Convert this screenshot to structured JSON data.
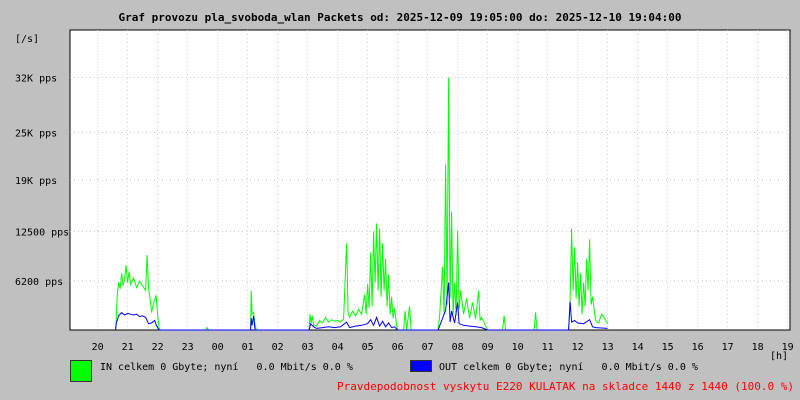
{
  "chart_data": {
    "type": "area",
    "title": "Graf provozu pla_svoboda_wlan Packets od: 2025-12-09 19:05:00 do: 2025-12-10 19:04:00",
    "ylabel": "[/s]",
    "xlabel": "[h]",
    "ylim": [
      0,
      38000
    ],
    "y_ticks": [
      {
        "label": "6200 pps",
        "value": 6200
      },
      {
        "label": "12500 pps",
        "value": 12500
      },
      {
        "label": "19K pps",
        "value": 19000
      },
      {
        "label": "25K pps",
        "value": 25000
      },
      {
        "label": "32K pps",
        "value": 32000
      }
    ],
    "x_ticks": [
      "20",
      "21",
      "22",
      "23",
      "00",
      "01",
      "02",
      "03",
      "04",
      "05",
      "06",
      "07",
      "08",
      "09",
      "10",
      "11",
      "12",
      "13",
      "14",
      "15",
      "16",
      "17",
      "18",
      "19"
    ],
    "xlim_hours": [
      19.08,
      24.0
    ],
    "series": [
      {
        "name": "IN",
        "color": "#00ff00",
        "points": [
          [
            20.6,
            0
          ],
          [
            20.62,
            1200
          ],
          [
            20.65,
            4200
          ],
          [
            20.7,
            6000
          ],
          [
            20.75,
            5200
          ],
          [
            20.8,
            7200
          ],
          [
            20.85,
            5600
          ],
          [
            20.9,
            6500
          ],
          [
            20.95,
            8200
          ],
          [
            21.0,
            6000
          ],
          [
            21.05,
            7400
          ],
          [
            21.1,
            5800
          ],
          [
            21.2,
            6600
          ],
          [
            21.3,
            5400
          ],
          [
            21.4,
            6200
          ],
          [
            21.5,
            5600
          ],
          [
            21.6,
            5000
          ],
          [
            21.65,
            9500
          ],
          [
            21.7,
            5200
          ],
          [
            21.75,
            4000
          ],
          [
            21.8,
            2200
          ],
          [
            21.85,
            3200
          ],
          [
            21.9,
            3800
          ],
          [
            21.95,
            4400
          ],
          [
            22.0,
            2000
          ],
          [
            22.05,
            200
          ],
          [
            22.1,
            0
          ],
          [
            23.6,
            0
          ],
          [
            23.65,
            300
          ],
          [
            23.7,
            0
          ],
          [
            25.1,
            0
          ],
          [
            25.12,
            5000
          ],
          [
            25.15,
            2000
          ],
          [
            25.2,
            2200
          ],
          [
            25.25,
            600
          ],
          [
            25.3,
            0
          ],
          [
            27.05,
            0
          ],
          [
            27.08,
            2000
          ],
          [
            27.12,
            900
          ],
          [
            27.16,
            1800
          ],
          [
            27.2,
            600
          ],
          [
            27.3,
            500
          ],
          [
            27.4,
            1200
          ],
          [
            27.5,
            900
          ],
          [
            27.6,
            1600
          ],
          [
            27.7,
            1000
          ],
          [
            27.8,
            1300
          ],
          [
            27.9,
            1100
          ],
          [
            28.0,
            1200
          ],
          [
            28.1,
            1000
          ],
          [
            28.2,
            1400
          ],
          [
            28.3,
            11000
          ],
          [
            28.35,
            2200
          ],
          [
            28.4,
            1600
          ],
          [
            28.5,
            2400
          ],
          [
            28.6,
            1800
          ],
          [
            28.7,
            2600
          ],
          [
            28.8,
            2000
          ],
          [
            28.9,
            4500
          ],
          [
            28.95,
            2000
          ],
          [
            29.0,
            5800
          ],
          [
            29.05,
            2800
          ],
          [
            29.1,
            9800
          ],
          [
            29.15,
            3000
          ],
          [
            29.2,
            12500
          ],
          [
            29.25,
            6000
          ],
          [
            29.3,
            13500
          ],
          [
            29.35,
            5000
          ],
          [
            29.4,
            12800
          ],
          [
            29.45,
            4200
          ],
          [
            29.5,
            11000
          ],
          [
            29.55,
            5000
          ],
          [
            29.6,
            9000
          ],
          [
            29.65,
            3000
          ],
          [
            29.7,
            7000
          ],
          [
            29.75,
            2000
          ],
          [
            29.8,
            4200
          ],
          [
            29.85,
            1500
          ],
          [
            29.9,
            2800
          ],
          [
            29.95,
            1000
          ],
          [
            30.0,
            0
          ],
          [
            30.2,
            0
          ],
          [
            30.25,
            2400
          ],
          [
            30.3,
            0
          ],
          [
            30.4,
            3000
          ],
          [
            30.45,
            0
          ],
          [
            31.35,
            0
          ],
          [
            31.4,
            1800
          ],
          [
            31.5,
            8000
          ],
          [
            31.55,
            2000
          ],
          [
            31.6,
            21000
          ],
          [
            31.65,
            3200
          ],
          [
            31.7,
            32000
          ],
          [
            31.75,
            4000
          ],
          [
            31.8,
            15000
          ],
          [
            31.85,
            2000
          ],
          [
            31.9,
            6000
          ],
          [
            31.95,
            1800
          ],
          [
            32.0,
            12500
          ],
          [
            32.05,
            2600
          ],
          [
            32.1,
            5000
          ],
          [
            32.2,
            2000
          ],
          [
            32.3,
            4000
          ],
          [
            32.4,
            1500
          ],
          [
            32.5,
            3500
          ],
          [
            32.6,
            1400
          ],
          [
            32.7,
            5000
          ],
          [
            32.75,
            1200
          ],
          [
            32.8,
            1600
          ],
          [
            32.9,
            800
          ],
          [
            33.0,
            0
          ],
          [
            33.5,
            0
          ],
          [
            33.55,
            1800
          ],
          [
            33.6,
            0
          ],
          [
            34.55,
            0
          ],
          [
            34.6,
            2200
          ],
          [
            34.65,
            0
          ],
          [
            35.7,
            0
          ],
          [
            35.75,
            3800
          ],
          [
            35.8,
            12800
          ],
          [
            35.85,
            5000
          ],
          [
            35.9,
            10500
          ],
          [
            35.95,
            4000
          ],
          [
            36.0,
            8500
          ],
          [
            36.05,
            3000
          ],
          [
            36.1,
            7200
          ],
          [
            36.15,
            2000
          ],
          [
            36.2,
            6000
          ],
          [
            36.25,
            3000
          ],
          [
            36.3,
            9000
          ],
          [
            36.35,
            5000
          ],
          [
            36.4,
            11500
          ],
          [
            36.45,
            3200
          ],
          [
            36.5,
            4200
          ],
          [
            36.6,
            1200
          ],
          [
            36.7,
            900
          ],
          [
            36.8,
            2000
          ],
          [
            36.9,
            1500
          ],
          [
            37.0,
            800
          ]
        ]
      },
      {
        "name": "OUT",
        "color": "#0000ff",
        "points": [
          [
            20.6,
            0
          ],
          [
            20.62,
            800
          ],
          [
            20.7,
            1800
          ],
          [
            20.8,
            2200
          ],
          [
            20.9,
            1900
          ],
          [
            21.0,
            2100
          ],
          [
            21.1,
            2000
          ],
          [
            21.2,
            1900
          ],
          [
            21.3,
            2000
          ],
          [
            21.4,
            1700
          ],
          [
            21.5,
            1800
          ],
          [
            21.6,
            1600
          ],
          [
            21.7,
            800
          ],
          [
            21.8,
            900
          ],
          [
            21.9,
            1200
          ],
          [
            21.95,
            700
          ],
          [
            22.0,
            300
          ],
          [
            22.05,
            0
          ],
          [
            25.1,
            0
          ],
          [
            25.12,
            1500
          ],
          [
            25.15,
            600
          ],
          [
            25.2,
            1800
          ],
          [
            25.25,
            0
          ],
          [
            27.05,
            0
          ],
          [
            27.1,
            800
          ],
          [
            27.2,
            400
          ],
          [
            27.3,
            200
          ],
          [
            27.5,
            300
          ],
          [
            27.7,
            400
          ],
          [
            27.9,
            300
          ],
          [
            28.1,
            400
          ],
          [
            28.3,
            1000
          ],
          [
            28.4,
            300
          ],
          [
            28.6,
            500
          ],
          [
            28.8,
            600
          ],
          [
            29.0,
            800
          ],
          [
            29.1,
            1300
          ],
          [
            29.2,
            600
          ],
          [
            29.3,
            1600
          ],
          [
            29.4,
            500
          ],
          [
            29.5,
            1100
          ],
          [
            29.6,
            400
          ],
          [
            29.7,
            900
          ],
          [
            29.8,
            300
          ],
          [
            29.9,
            400
          ],
          [
            30.0,
            0
          ],
          [
            31.35,
            0
          ],
          [
            31.5,
            1500
          ],
          [
            31.6,
            2500
          ],
          [
            31.7,
            6000
          ],
          [
            31.75,
            1000
          ],
          [
            31.8,
            2400
          ],
          [
            31.9,
            900
          ],
          [
            32.0,
            3500
          ],
          [
            32.05,
            800
          ],
          [
            32.2,
            600
          ],
          [
            32.4,
            500
          ],
          [
            32.6,
            400
          ],
          [
            32.8,
            300
          ],
          [
            33.0,
            0
          ],
          [
            35.7,
            0
          ],
          [
            35.75,
            3600
          ],
          [
            35.8,
            1000
          ],
          [
            35.9,
            1200
          ],
          [
            36.0,
            900
          ],
          [
            36.2,
            800
          ],
          [
            36.4,
            1300
          ],
          [
            36.5,
            400
          ],
          [
            36.6,
            300
          ],
          [
            37.0,
            200
          ]
        ]
      }
    ]
  },
  "legend": {
    "in_text": "IN celkem 0 Gbyte; nyní   0.0 Mbit/s 0.0 %",
    "out_text": "OUT celkem 0 Gbyte; nyní   0.0 Mbit/s 0.0 %",
    "in_color": "#00ff00",
    "out_color": "#0000ff"
  },
  "probability_note": "Pravdepodobnost vyskytu E220 KULATAK na skladce 1440 z 1440 (100.0 %)"
}
